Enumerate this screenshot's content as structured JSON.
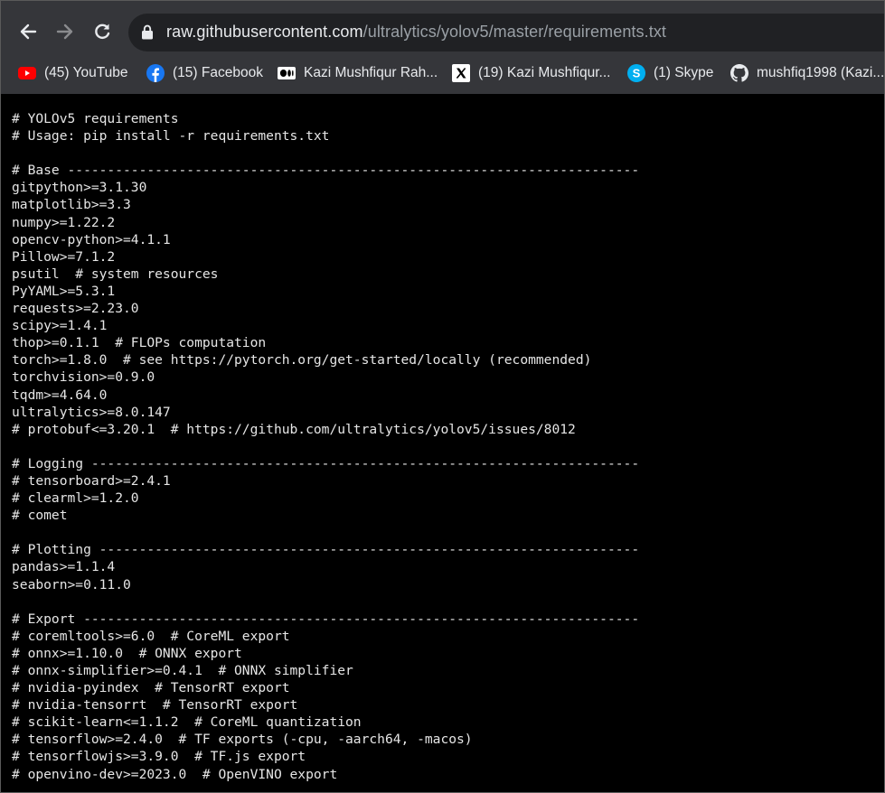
{
  "browser": {
    "url_domain": "raw.githubusercontent.com",
    "url_path": "/ultralytics/yolov5/master/requirements.txt",
    "bookmarks": [
      {
        "label": "(45) YouTube",
        "icon": "youtube-icon"
      },
      {
        "label": "(15) Facebook",
        "icon": "facebook-icon"
      },
      {
        "label": "Kazi Mushfiqur Rah...",
        "icon": "medium-icon"
      },
      {
        "label": "(19) Kazi Mushfiqur...",
        "icon": "x-icon"
      },
      {
        "label": "(1) Skype",
        "icon": "skype-icon"
      },
      {
        "label": "mushfiq1998 (Kazi...",
        "icon": "github-icon"
      }
    ]
  },
  "file_text": "# YOLOv5 requirements\n# Usage: pip install -r requirements.txt\n\n# Base ------------------------------------------------------------------------\ngitpython>=3.1.30\nmatplotlib>=3.3\nnumpy>=1.22.2\nopencv-python>=4.1.1\nPillow>=7.1.2\npsutil  # system resources\nPyYAML>=5.3.1\nrequests>=2.23.0\nscipy>=1.4.1\nthop>=0.1.1  # FLOPs computation\ntorch>=1.8.0  # see https://pytorch.org/get-started/locally (recommended)\ntorchvision>=0.9.0\ntqdm>=4.64.0\nultralytics>=8.0.147\n# protobuf<=3.20.1  # https://github.com/ultralytics/yolov5/issues/8012\n\n# Logging ---------------------------------------------------------------------\n# tensorboard>=2.4.1\n# clearml>=1.2.0\n# comet\n\n# Plotting --------------------------------------------------------------------\npandas>=1.1.4\nseaborn>=0.11.0\n\n# Export ----------------------------------------------------------------------\n# coremltools>=6.0  # CoreML export\n# onnx>=1.10.0  # ONNX export\n# onnx-simplifier>=0.4.1  # ONNX simplifier\n# nvidia-pyindex  # TensorRT export\n# nvidia-tensorrt  # TensorRT export\n# scikit-learn<=1.1.2  # CoreML quantization\n# tensorflow>=2.4.0  # TF exports (-cpu, -aarch64, -macos)\n# tensorflowjs>=3.9.0  # TF.js export\n# openvino-dev>=2023.0  # OpenVINO export"
}
